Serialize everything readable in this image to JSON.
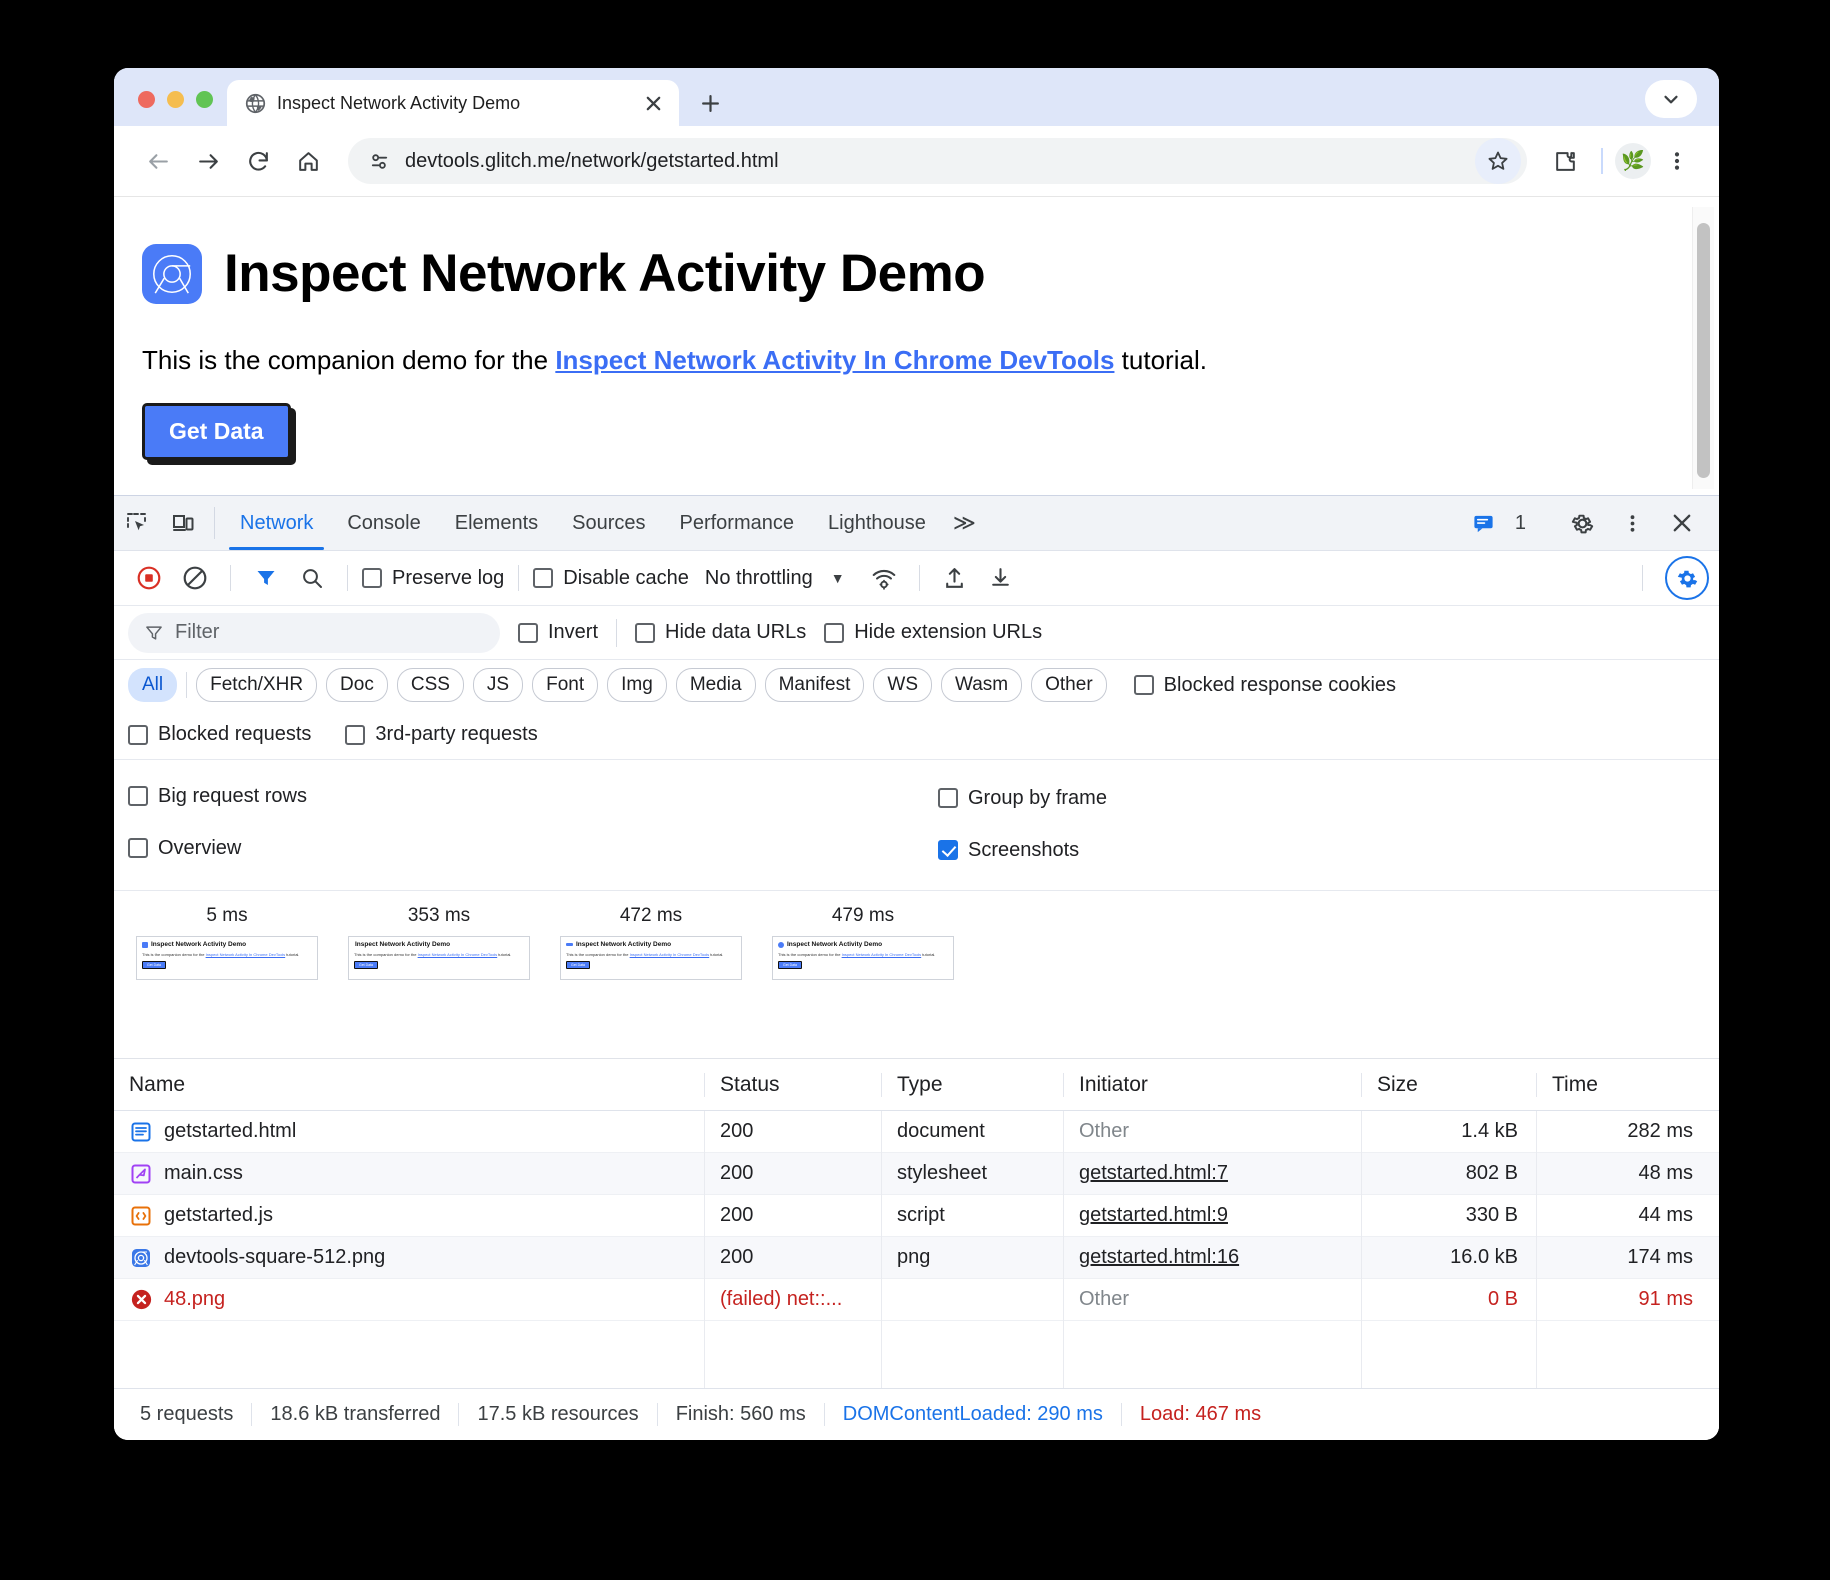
{
  "browser": {
    "tab": {
      "title": "Inspect Network Activity Demo",
      "favicon": "globe-icon"
    },
    "newtab_label": "+",
    "close_label": "×",
    "tabstrip_chevron": "⌄",
    "omnibox": {
      "url": "devtools.glitch.me/network/getstarted.html",
      "site_info_icon": "tune-icon",
      "star_icon": "bookmark-star-icon"
    },
    "nav": {
      "back": "←",
      "forward": "→",
      "reload": "⟳",
      "home": "⌂"
    },
    "extensions_icon": "puzzle-piece-icon",
    "profile_icon": "🌿",
    "menu_icon": "kebab-menu-icon"
  },
  "page": {
    "title": "Inspect Network Activity Demo",
    "paragraph_before": "This is the companion demo for the ",
    "link_text": "Inspect Network Activity In Chrome DevTools",
    "paragraph_after": " tutorial.",
    "button_label": "Get Data"
  },
  "devtools": {
    "tabs": [
      {
        "label": "Network",
        "active": true
      },
      {
        "label": "Console",
        "active": false
      },
      {
        "label": "Elements",
        "active": false
      },
      {
        "label": "Sources",
        "active": false
      },
      {
        "label": "Performance",
        "active": false
      },
      {
        "label": "Lighthouse",
        "active": false
      }
    ],
    "more_tabs_label": "≫",
    "inspect_icon": "inspect-element-icon",
    "device_icon": "device-toolbar-icon",
    "message_count": "1",
    "message_icon": "console-message-icon",
    "settings_icon": "gear-icon",
    "kebab_icon": "kebab-menu-icon",
    "close_icon": "close-icon",
    "toolbar": {
      "record_icon": "record-stop-icon",
      "clear_icon": "clear-icon",
      "filter_icon": "filter-funnel-icon",
      "search_icon": "search-icon",
      "preserve_log": {
        "label": "Preserve log",
        "checked": false
      },
      "disable_cache": {
        "label": "Disable cache",
        "checked": false
      },
      "throttling": "No throttling",
      "throttling_caret": "▼",
      "network_conditions_icon": "wifi-settings-icon",
      "import_icon": "import-har-icon",
      "export_icon": "export-har-icon",
      "settings_toggle_icon": "network-settings-gear-icon"
    },
    "filterbar": {
      "placeholder": "Filter",
      "funnel_icon": "filter-funnel-icon",
      "invert": {
        "label": "Invert",
        "checked": false
      },
      "hide_data_urls": {
        "label": "Hide data URLs",
        "checked": false
      },
      "hide_extension_urls": {
        "label": "Hide extension URLs",
        "checked": false
      }
    },
    "type_filters": [
      {
        "label": "All",
        "selected": true
      },
      {
        "label": "Fetch/XHR",
        "selected": false
      },
      {
        "label": "Doc",
        "selected": false
      },
      {
        "label": "CSS",
        "selected": false
      },
      {
        "label": "JS",
        "selected": false
      },
      {
        "label": "Font",
        "selected": false
      },
      {
        "label": "Img",
        "selected": false
      },
      {
        "label": "Media",
        "selected": false
      },
      {
        "label": "Manifest",
        "selected": false
      },
      {
        "label": "WS",
        "selected": false
      },
      {
        "label": "Wasm",
        "selected": false
      },
      {
        "label": "Other",
        "selected": false
      }
    ],
    "blocked_response_cookies": {
      "label": "Blocked response cookies",
      "checked": false
    },
    "blocked_requests": {
      "label": "Blocked requests",
      "checked": false
    },
    "third_party_requests": {
      "label": "3rd-party requests",
      "checked": false
    },
    "settings_panel": {
      "big_request_rows": {
        "label": "Big request rows",
        "checked": false
      },
      "group_by_frame": {
        "label": "Group by frame",
        "checked": false
      },
      "overview": {
        "label": "Overview",
        "checked": false
      },
      "screenshots": {
        "label": "Screenshots",
        "checked": true
      }
    },
    "filmstrip": [
      {
        "time": "5 ms"
      },
      {
        "time": "353 ms"
      },
      {
        "time": "472 ms"
      },
      {
        "time": "479 ms"
      }
    ],
    "filmstrip_thumb": {
      "title": "Inspect Network Activity Demo",
      "text_before": "This is the companion demo for the ",
      "link": "Inspect Network Activity In Chrome DevTools",
      "text_after": " tutorial.",
      "button": "Get Data"
    },
    "table": {
      "columns": [
        "Name",
        "Status",
        "Type",
        "Initiator",
        "Size",
        "Time"
      ],
      "rows": [
        {
          "icon": "document-icon",
          "name": "getstarted.html",
          "status": "200",
          "type": "document",
          "initiator": "Other",
          "initiator_muted": true,
          "size": "1.4 kB",
          "time": "282 ms",
          "failed": false
        },
        {
          "icon": "stylesheet-icon",
          "name": "main.css",
          "status": "200",
          "type": "stylesheet",
          "initiator": "getstarted.html:7",
          "initiator_muted": false,
          "size": "802 B",
          "time": "48 ms",
          "failed": false
        },
        {
          "icon": "script-icon",
          "name": "getstarted.js",
          "status": "200",
          "type": "script",
          "initiator": "getstarted.html:9",
          "initiator_muted": false,
          "size": "330 B",
          "time": "44 ms",
          "failed": false
        },
        {
          "icon": "image-icon",
          "name": "devtools-square-512.png",
          "status": "200",
          "type": "png",
          "initiator": "getstarted.html:16",
          "initiator_muted": false,
          "size": "16.0 kB",
          "time": "174 ms",
          "failed": false
        },
        {
          "icon": "error-icon",
          "name": "48.png",
          "status": "(failed) net::...",
          "type": "",
          "initiator": "Other",
          "initiator_muted": true,
          "size": "0 B",
          "time": "91 ms",
          "failed": true
        }
      ]
    },
    "statusbar": {
      "requests": "5 requests",
      "transferred": "18.6 kB transferred",
      "resources": "17.5 kB resources",
      "finish": "Finish: 560 ms",
      "dom_content_loaded": "DOMContentLoaded: 290 ms",
      "load": "Load: 467 ms"
    }
  },
  "colors": {
    "accent": "#1a73e8",
    "error": "#c5221f",
    "chip_selected_bg": "#d3e3fd",
    "tabstrip_bg": "#dee6f9"
  }
}
